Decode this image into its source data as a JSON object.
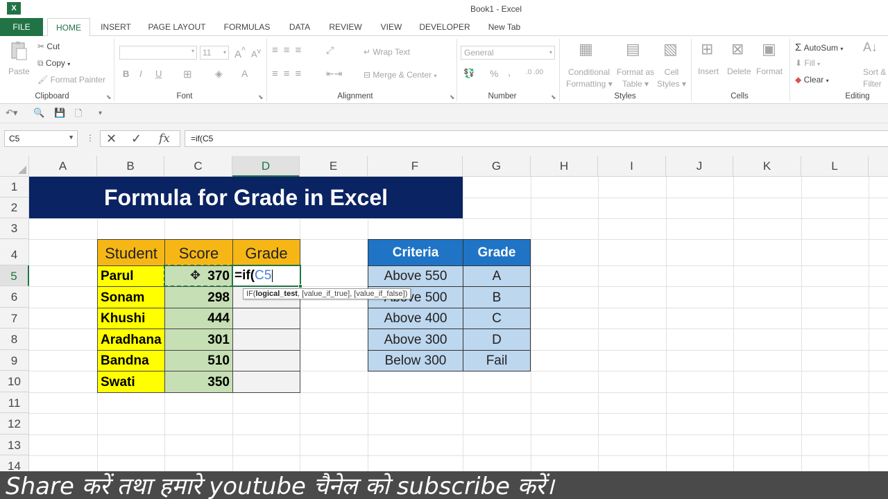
{
  "window": {
    "title": "Book1 - Excel",
    "logo": "X"
  },
  "tabs": [
    "FILE",
    "HOME",
    "INSERT",
    "PAGE LAYOUT",
    "FORMULAS",
    "DATA",
    "REVIEW",
    "VIEW",
    "DEVELOPER",
    "New Tab"
  ],
  "ribbon": {
    "clipboard": {
      "paste": "Paste",
      "cut": "Cut",
      "copy": "Copy",
      "format_painter": "Format Painter",
      "label": "Clipboard"
    },
    "font": {
      "size": "11",
      "label": "Font",
      "bold": "B",
      "italic": "I",
      "underline": "U",
      "grow": "A",
      "shrink": "A",
      "font_color": "A"
    },
    "alignment": {
      "wrap_text": "Wrap Text",
      "merge_center": "Merge & Center",
      "label": "Alignment"
    },
    "number": {
      "format": "General",
      "percent": "%",
      "comma": ",",
      "label": "Number"
    },
    "styles": {
      "conditional": "Conditional",
      "formatting": "Formatting",
      "format_as": "Format as",
      "table": "Table",
      "cell": "Cell",
      "styles": "Styles",
      "label": "Styles"
    },
    "cells": {
      "insert": "Insert",
      "delete": "Delete",
      "format": "Format",
      "label": "Cells"
    },
    "editing": {
      "autosum": "AutoSum",
      "fill": "Fill",
      "clear": "Clear",
      "sort": "Sort &",
      "filter": "Filter",
      "label": "Editing"
    }
  },
  "formula_bar": {
    "name_box": "C5",
    "formula": "=if(C5",
    "fx": "fx"
  },
  "columns": [
    "A",
    "B",
    "C",
    "D",
    "E",
    "F",
    "G",
    "H",
    "I",
    "J",
    "K",
    "L"
  ],
  "rows": [
    "1",
    "2",
    "3",
    "4",
    "5",
    "6",
    "7",
    "8",
    "9",
    "10",
    "11",
    "12",
    "13",
    "14"
  ],
  "banner": "Formula for Grade in Excel",
  "student_table": {
    "headers": [
      "Student",
      "Score",
      "Grade"
    ],
    "rows": [
      {
        "student": "Parul",
        "score": "370"
      },
      {
        "student": "Sonam",
        "score": "298"
      },
      {
        "student": "Khushi",
        "score": "444"
      },
      {
        "student": "Aradhana",
        "score": "301"
      },
      {
        "student": "Bandna",
        "score": "510"
      },
      {
        "student": "Swati",
        "score": "350"
      }
    ]
  },
  "editing_cell": {
    "prefix": "=if(",
    "ref": "C5"
  },
  "tooltip": {
    "fn": "IF(",
    "arg1": "logical_test",
    "rest": ", [value_if_true], [value_if_false])"
  },
  "criteria_table": {
    "headers": [
      "Criteria",
      "Grade"
    ],
    "rows": [
      {
        "criteria": "Above 550",
        "grade": "A"
      },
      {
        "criteria": "Above 500",
        "grade": "B"
      },
      {
        "criteria": "Above 400",
        "grade": "C"
      },
      {
        "criteria": "Above 300",
        "grade": "D"
      },
      {
        "criteria": "Below 300",
        "grade": "Fail"
      }
    ]
  },
  "caption": "Share करें तथा हमारे youtube चैनेल को subscribe करें।",
  "colors": {
    "excel_green": "#217346",
    "banner": "#0a2363",
    "header_orange": "#f6b716",
    "name_yellow": "#ffff00",
    "score_green": "#c6dfb4",
    "criteria_header": "#1f74c6",
    "criteria_body": "#bdd7ee"
  }
}
